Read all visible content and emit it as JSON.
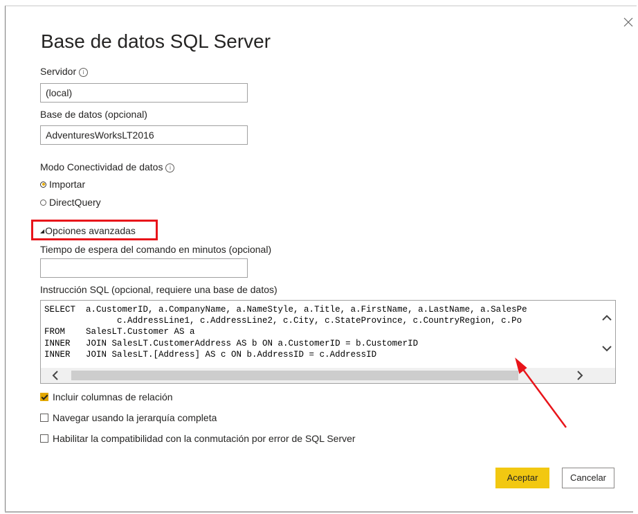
{
  "dialog": {
    "title": "Base de datos SQL Server",
    "close_icon": "close-icon"
  },
  "server": {
    "label": "Servidor",
    "value": "(local)"
  },
  "database": {
    "label": "Base de datos (opcional)",
    "value": "AdventuresWorksLT2016"
  },
  "connectivity": {
    "label": "Modo Conectividad de datos",
    "options": [
      {
        "label": "Importar",
        "selected": true
      },
      {
        "label": "DirectQuery",
        "selected": false
      }
    ]
  },
  "advanced": {
    "label": "Opciones avanzadas",
    "timeout_label": "Tiempo de espera del comando en minutos (opcional)",
    "timeout_value": "",
    "sql_label": "Instrucción SQL (opcional, requiere una base de datos)",
    "sql_lines": [
      "SELECT  a.CustomerID, a.CompanyName, a.NameStyle, a.Title, a.FirstName, a.LastName, a.SalesPe",
      "              c.AddressLine1, c.AddressLine2, c.City, c.StateProvince, c.CountryRegion, c.Po",
      "FROM    SalesLT.Customer AS a",
      "INNER   JOIN SalesLT.CustomerAddress AS b ON a.CustomerID = b.CustomerID",
      "INNER   JOIN SalesLT.[Address] AS c ON b.AddressID = c.AddressID"
    ]
  },
  "options": [
    {
      "label": "Incluir columnas de relación",
      "checked": true
    },
    {
      "label": "Navegar usando la jerarquía completa",
      "checked": false
    },
    {
      "label": "Habilitar la compatibilidad con la conmutación por error de SQL Server",
      "checked": false
    }
  ],
  "buttons": {
    "accept": "Aceptar",
    "cancel": "Cancelar"
  },
  "colors": {
    "accent": "#f2c811",
    "highlight": "#e8141a"
  }
}
